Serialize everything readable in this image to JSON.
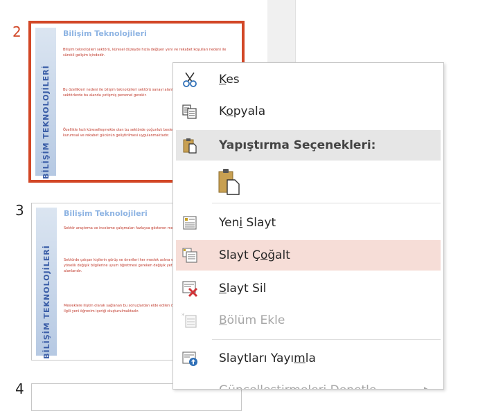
{
  "slides": [
    {
      "number": "2",
      "title": "Bilişim Teknolojileri",
      "band": "BİLİŞİM TEKNOLOJİLERİ",
      "paragraphs": [
        "Bilişim teknolojileri sektörü, küresel düzeyde hızla değişen yeni ve rekabet koşulları nedeni ile sürekli gelişim içindedir.",
        "Bu özellikleri nedeni ile bilişim teknolojileri sektörü sanayi alanlarında önemli bir yere sahiptir. Tüm sektörlerde bu alanda yetişmiş personel gerekir.",
        "Özellikle hızlı küreselleşmekte olan bu sektörde çoğunluk beslenmekte ve sanayileşme sürecinde kurumsal ve rekabet gücünün geliştirilmesi uygulanmaktadır."
      ]
    },
    {
      "number": "3",
      "title": "Bilişim Teknolojileri",
      "band": "BİLİŞİM TEKNOLOJİLERİ",
      "paragraphs": [
        "Sektör araştırma ve inceleme çalışmaları fazlaysa gösteren meslekler saptanmıştır.",
        "Sektörde çalışan kişilerin görüş ve önerileri her meslek aslına eli ortaklaşılan. Yeni ve erkekler yönelik değişik bilgilerine uyum öğretmesi gereken değişik yetenek yanı sıra ayrı ayrı eğitim alanlarıdır.",
        "Mesleklere ilişkin olarak sağlanan bu sonuçlardan elde edilen öğretim programları ve modülleri ile ilgili yeni öğrenim içeriği oluşturulmaktadır."
      ]
    },
    {
      "number": "4"
    }
  ],
  "menu": {
    "cut": {
      "pre": "",
      "ul": "K",
      "post": "es"
    },
    "copy": {
      "pre": "K",
      "ul": "o",
      "post": "pyala"
    },
    "paste_options": "Yapıştırma Seçenekleri:",
    "new_slide": {
      "pre": "Yen",
      "ul": "i",
      "post": " Slayt"
    },
    "duplicate_slide": {
      "pre": "Slayt Ç",
      "ul": "o",
      "post": "ğalt"
    },
    "delete_slide": {
      "pre": "",
      "ul": "S",
      "post": "layt Sil"
    },
    "add_section": {
      "pre": "",
      "ul": "B",
      "post": "ölüm Ekle"
    },
    "publish_slides": {
      "pre": "Slaytları Yayı",
      "ul": "m",
      "post": "la"
    },
    "check_updates": "Güncelleştirmeleri Denetle"
  },
  "colors": {
    "selected_border": "#d24726",
    "hover_bg": "#f6ddd7",
    "header_bg": "#e6e6e6",
    "slide_title": "#8eb4e3",
    "slide_text": "#c0392b"
  }
}
